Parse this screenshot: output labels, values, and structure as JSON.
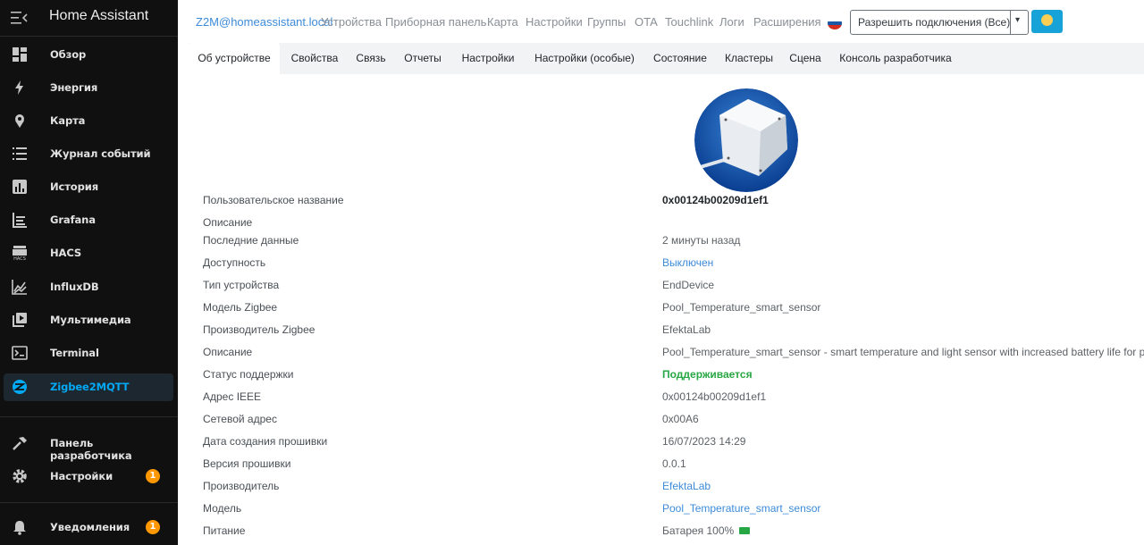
{
  "app": {
    "title": "Home Assistant"
  },
  "sidebar": {
    "items": [
      {
        "label": "Обзор",
        "icon": "dashboard-icon"
      },
      {
        "label": "Энергия",
        "icon": "lightning-icon"
      },
      {
        "label": "Карта",
        "icon": "map-icon"
      },
      {
        "label": "Журнал событий",
        "icon": "logbook-icon"
      },
      {
        "label": "История",
        "icon": "history-chart-icon"
      },
      {
        "label": "Grafana",
        "icon": "grafana-icon"
      },
      {
        "label": "HACS",
        "icon": "hacs-icon"
      },
      {
        "label": "InfluxDB",
        "icon": "influxdb-icon"
      },
      {
        "label": "Мультимедиа",
        "icon": "media-icon"
      },
      {
        "label": "Terminal",
        "icon": "terminal-icon"
      },
      {
        "label": "Zigbee2MQTT",
        "icon": "zigbee-icon",
        "active": true
      }
    ],
    "bottom": [
      {
        "label": "Панель разработчика",
        "icon": "hammer-icon"
      },
      {
        "label": "Настройки",
        "icon": "gear-icon",
        "badge": "1"
      },
      {
        "label": "Уведомления",
        "icon": "bell-icon",
        "badge": "1"
      }
    ]
  },
  "topnav": {
    "brand": "Z2M@homeassistant.local",
    "links": [
      "Устройства",
      "Приборная панель",
      "Карта",
      "Настройки",
      "Группы",
      "OTA",
      "Touchlink",
      "Логи",
      "Расширения"
    ],
    "language_flag": "russia-flag-icon",
    "permit_join": "Разрешить подключения (Все)"
  },
  "tabs": [
    "Об устройстве",
    "Свойства",
    "Связь",
    "Отчеты",
    "Настройки",
    "Настройки (особые)",
    "Состояние",
    "Кластеры",
    "Сцена",
    "Консоль разработчика"
  ],
  "device": {
    "rows": [
      {
        "key": "Пользовательское название",
        "value": "0x00124b00209d1ef1"
      },
      {
        "key": "Описание",
        "value": ""
      },
      {
        "key": "Последние данные",
        "value": "2 минуты назад"
      },
      {
        "key": "Доступность",
        "value": "Выключен"
      },
      {
        "key": "Тип устройства",
        "value": "EndDevice"
      },
      {
        "key": "Модель Zigbee",
        "value": "Pool_Temperature_smart_sensor"
      },
      {
        "key": "Производитель Zigbee",
        "value": "EfektaLab"
      },
      {
        "key": "Описание",
        "value": "Pool_Temperature_smart_sensor - smart temperature and light sensor with increased battery life for pool"
      },
      {
        "key": "Статус поддержки",
        "value": "Поддерживается"
      },
      {
        "key": "Адрес IEEE",
        "value": "0x00124b00209d1ef1"
      },
      {
        "key": "Сетевой адрес",
        "value": "0x00A6"
      },
      {
        "key": "Дата создания прошивки",
        "value": "16/07/2023 14:29"
      },
      {
        "key": "Версия прошивки",
        "value": "0.0.1"
      },
      {
        "key": "Производитель",
        "value": "EfektaLab"
      },
      {
        "key": "Модель",
        "value": "Pool_Temperature_smart_sensor"
      },
      {
        "key": "Питание",
        "value": "Батарея 100%",
        "icon": "battery-full-icon"
      }
    ]
  },
  "colors": {
    "accent": "#03a9f4",
    "link": "#3d8bd9",
    "ok": "#28a745",
    "badge": "#ff9800",
    "sidebar_bg": "#101010"
  }
}
